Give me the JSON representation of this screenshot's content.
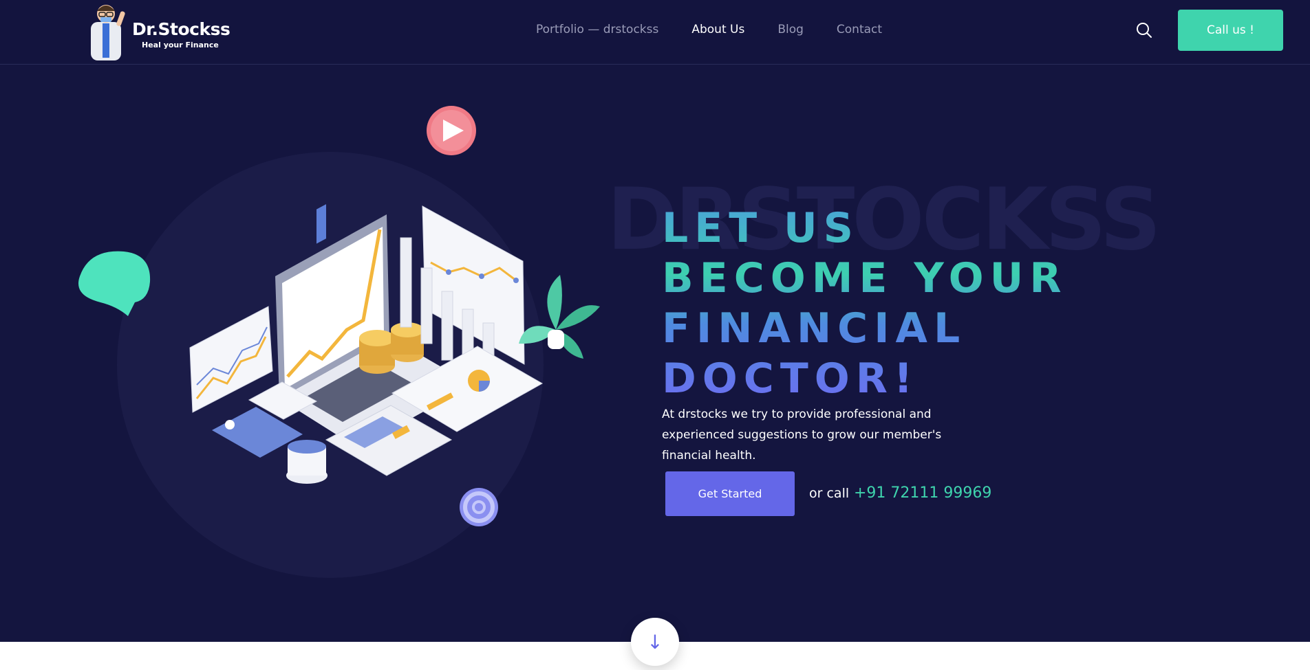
{
  "logo": {
    "title": "Dr.Stockss",
    "tagline": "Heal your Finance"
  },
  "nav": {
    "items": [
      {
        "label": "Portfolio — drstockss",
        "active": false
      },
      {
        "label": "About Us",
        "active": true
      },
      {
        "label": "Blog",
        "active": false
      },
      {
        "label": "Contact",
        "active": false
      }
    ]
  },
  "header": {
    "search_icon": "search-icon",
    "call_label": "Call us !"
  },
  "hero": {
    "watermark": "DRSTOCKSS",
    "headline_lines": [
      "LET US",
      "BECOME YOUR",
      "FINANCIAL",
      "DOCTOR!"
    ],
    "subtext": "At drstocks we try to provide professional and experienced suggestions to grow our member's financial health.",
    "cta_label": "Get Started",
    "or_call": "or call",
    "phone": "+91 72111 99969"
  },
  "colors": {
    "background": "#14153f",
    "accent_teal": "#3fd4ad",
    "accent_purple": "#6467e8"
  },
  "scroll_icon": "arrow-down-icon"
}
